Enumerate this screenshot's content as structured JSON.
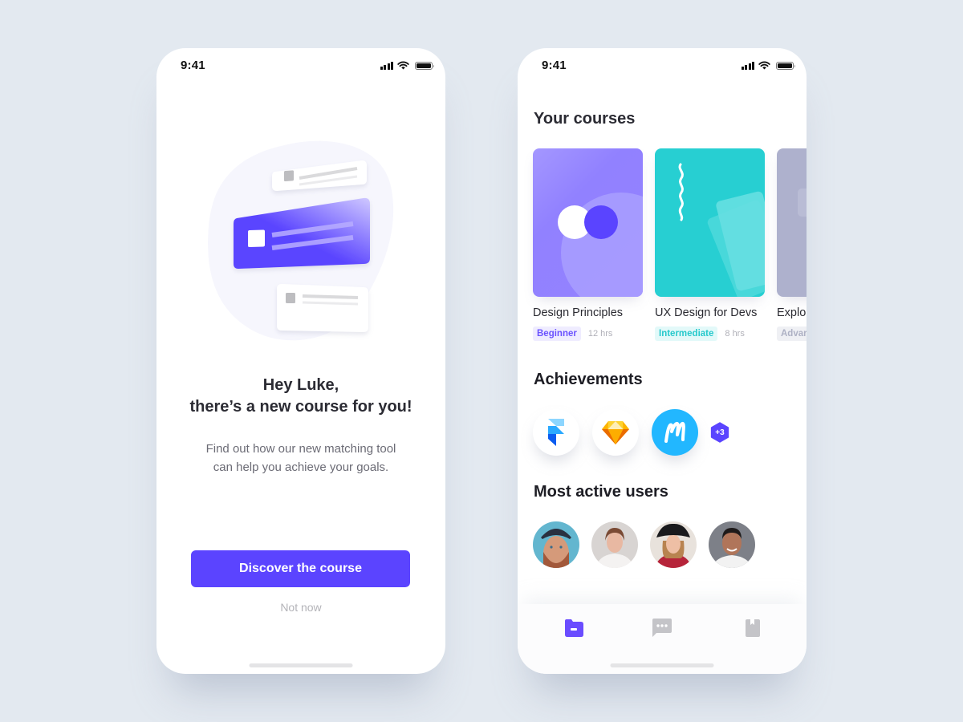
{
  "left_screen": {
    "status_bar": {
      "time": "9:41"
    },
    "greeting": {
      "line1": "Hey Luke,",
      "line2": "there’s a new course for you!"
    },
    "description": {
      "line1": "Find out how our new matching tool",
      "line2": "can help you achieve your goals."
    },
    "primary_button": "Discover the course",
    "secondary_link": "Not now",
    "illustration": "course-cards-illustration"
  },
  "right_screen": {
    "status_bar": {
      "time": "9:41"
    },
    "courses_section": {
      "title": "Your courses",
      "courses": [
        {
          "name": "Design Principles",
          "level": "Beginner",
          "duration": "12 hrs",
          "color": "#9684ff",
          "badge_bg": "#efecff",
          "badge_fg": "#6a52ff"
        },
        {
          "name": "UX Design for Devs",
          "level": "Intermediate",
          "duration": "8 hrs",
          "color": "#27cfd2",
          "badge_bg": "#e3f9f9",
          "badge_fg": "#27c9cc"
        },
        {
          "name": "Explor",
          "level": "Advar",
          "duration": "",
          "color": "#aeb1cd",
          "badge_bg": "#eff0f4",
          "badge_fg": "#aeb1c4"
        }
      ]
    },
    "achievements_section": {
      "title": "Achievements",
      "badges": [
        {
          "name": "Framer",
          "icon": "framer-icon"
        },
        {
          "name": "Sketch",
          "icon": "sketch-icon"
        },
        {
          "name": "Marvel",
          "icon": "marvel-icon"
        }
      ],
      "more_count": "+3"
    },
    "users_section": {
      "title": "Most active users",
      "users": [
        {
          "avatar": "user-avatar-1"
        },
        {
          "avatar": "user-avatar-2"
        },
        {
          "avatar": "user-avatar-3"
        },
        {
          "avatar": "user-avatar-4"
        }
      ]
    },
    "tab_bar": {
      "tabs": [
        {
          "icon": "folder-icon",
          "active": true
        },
        {
          "icon": "chat-icon",
          "active": false
        },
        {
          "icon": "bookmark-icon",
          "active": false
        }
      ]
    }
  },
  "colors": {
    "accent": "#5b44ff",
    "background": "#e3e9f0",
    "text_primary": "#1d1d24",
    "text_secondary": "#6b6b75",
    "muted": "#b3b3b8"
  }
}
